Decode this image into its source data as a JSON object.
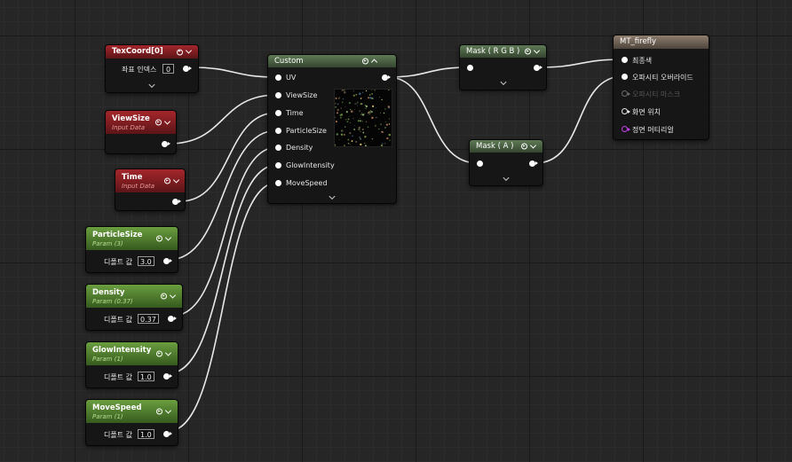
{
  "nodes": {
    "texcoord": {
      "title": "TexCoord[0]",
      "coord_index_label": "좌표 인덱스",
      "coord_index_value": "0"
    },
    "viewsize": {
      "title": "ViewSize",
      "subtitle": "Input Data"
    },
    "time": {
      "title": "Time",
      "subtitle": "Input Data"
    },
    "particlesize": {
      "title": "ParticleSize",
      "subtitle": "Param (3)",
      "default_label": "디폴트 값",
      "value": "3.0"
    },
    "density": {
      "title": "Density",
      "subtitle": "Param (0.37)",
      "default_label": "디폴트 값",
      "value": "0.37"
    },
    "glowintensity": {
      "title": "GlowIntensity",
      "subtitle": "Param (1)",
      "default_label": "디폴트 값",
      "value": "1.0"
    },
    "movespeed": {
      "title": "MoveSpeed",
      "subtitle": "Param (1)",
      "default_label": "디폴트 값",
      "value": "1.0"
    },
    "custom": {
      "title": "Custom",
      "inputs": [
        "UV",
        "ViewSize",
        "Time",
        "ParticleSize",
        "Density",
        "GlowIntensity",
        "MoveSpeed"
      ]
    },
    "mask_rgb": {
      "title": "Mask ( R G B )"
    },
    "mask_a": {
      "title": "Mask ( A )"
    },
    "material": {
      "title": "MT_firefly",
      "pins": [
        "최종색",
        "오파시티 오버라이드",
        "오파시티 마스크",
        "화면 위치",
        "정면 머티리얼"
      ]
    }
  },
  "colors": {
    "wire": "#e8e8e8",
    "red_header": "#a4262b",
    "green_header": "#6a9e3f",
    "purple_pin": "#c040e8"
  }
}
